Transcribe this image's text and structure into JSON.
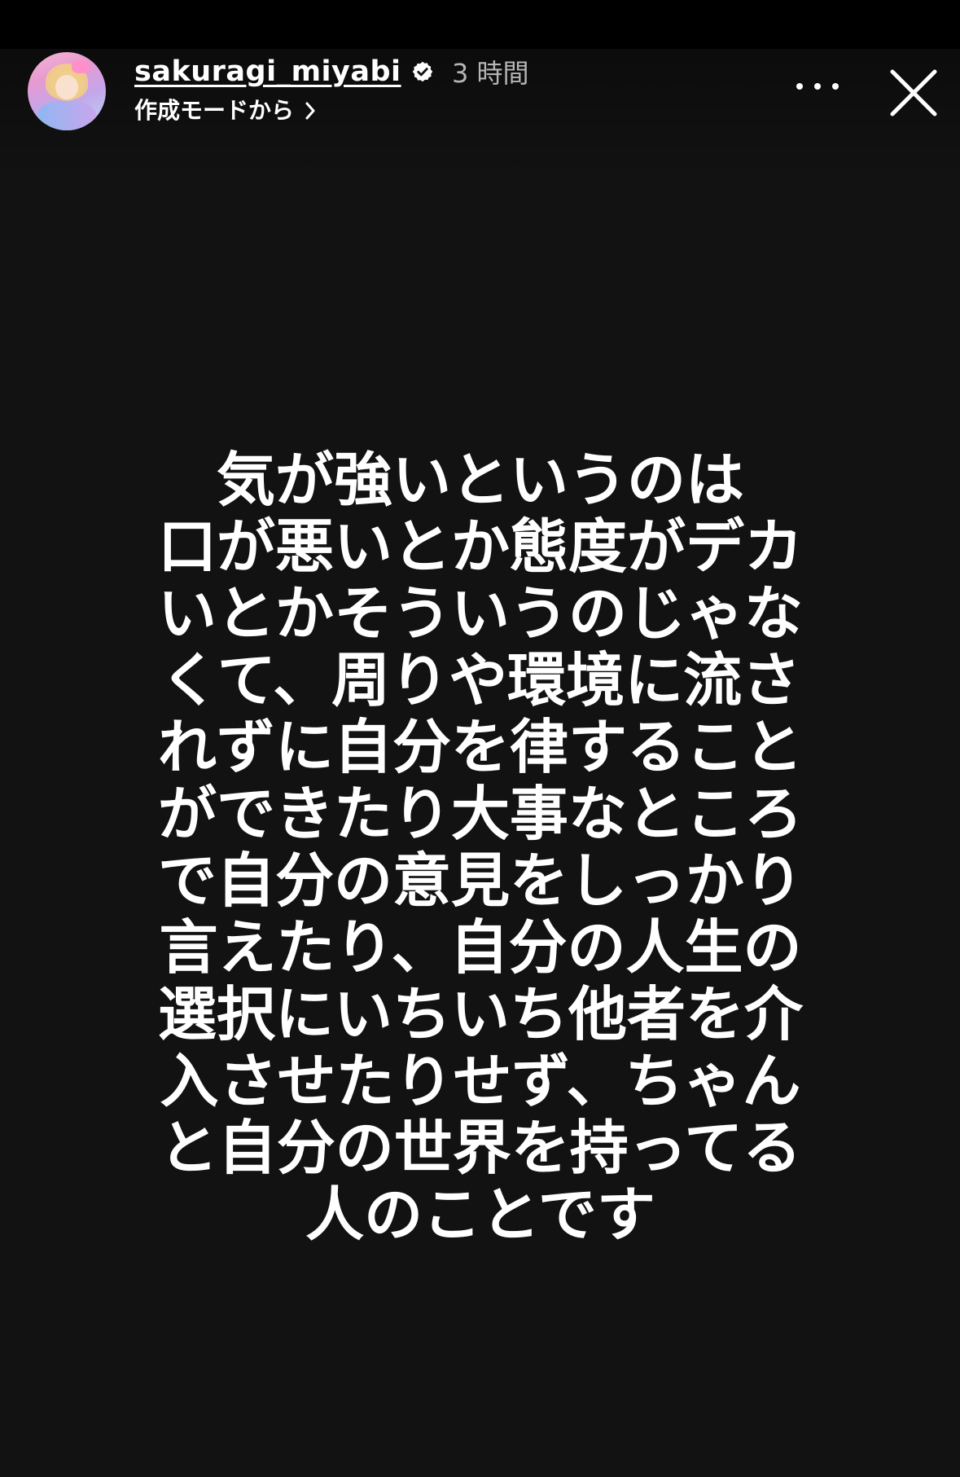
{
  "header": {
    "username": "sakuragi_miyabi",
    "time": "3 時間",
    "subline": "作成モードから"
  },
  "icons": {
    "verified": "verified-badge-icon",
    "chevron": "chevron-right-icon",
    "more": "more-options-icon",
    "close": "close-icon"
  },
  "colors": {
    "background": "#121212",
    "text": "#ffffff",
    "secondary_text": "#b5b5b5"
  },
  "story": {
    "lines": [
      "気が強いというのは",
      "口が悪いとか態度がデカ",
      "いとかそういうのじゃな",
      "くて、周りや環境に流さ",
      "れずに自分を律すること",
      "ができたり大事なところ",
      "で自分の意見をしっかり",
      "言えたり、自分の人生の",
      "選択にいちいち他者を介",
      "入させたりせず、ちゃん",
      "と自分の世界を持ってる",
      "人のことです"
    ]
  }
}
